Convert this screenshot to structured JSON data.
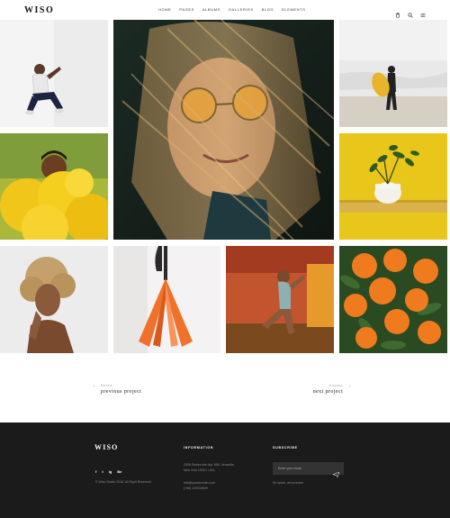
{
  "header": {
    "logo": "WISO",
    "nav": [
      "HOME",
      "PAGES",
      "ALBUMS",
      "GALLERIES",
      "BLOG",
      "ELEMENTS"
    ],
    "icons": [
      "cart-icon",
      "search-icon",
      "menu-icon"
    ]
  },
  "gallery": {
    "tiles": [
      {
        "subject": "person-sitting-pose"
      },
      {
        "subject": "woman-sunglasses-hair"
      },
      {
        "subject": "surfer-on-beach"
      },
      {
        "subject": "man-yellow-smoke"
      },
      {
        "subject": "plant-yellow-wall"
      },
      {
        "subject": "curly-hair-woman"
      },
      {
        "subject": "orange-umbrella"
      },
      {
        "subject": "woman-swimsuit"
      },
      {
        "subject": "oranges-leaves"
      }
    ]
  },
  "pagination": {
    "prev_small": "Nexus",
    "prev_label": "previous project",
    "next_small": "Scusso",
    "next_label": "next project"
  },
  "footer": {
    "logo": "WISO",
    "social": [
      "f",
      "t",
      "ig",
      "Be"
    ],
    "copyright": "© Wiso Studio 2018. All Right Reserved.",
    "info_heading": "INFORMATION",
    "address_1": "2005 Stokes Isle Apt. 896, Venaville,",
    "address_2": "New York 10010, USA",
    "email": "info@yourdomain.com",
    "phone": "(+68) 120034509",
    "subscribe_heading": "SUBSCRIBE",
    "email_placeholder": "Enter your email",
    "spam_note": "No spam, we promise"
  }
}
